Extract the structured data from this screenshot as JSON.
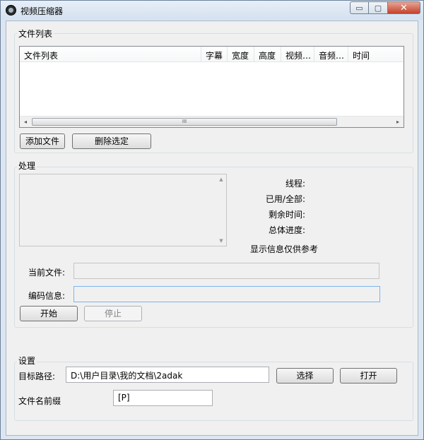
{
  "window": {
    "title": "视频压缩器",
    "min_glyph": "▭",
    "max_glyph": "▢",
    "close_glyph": "✕"
  },
  "file_list": {
    "group_label": "文件列表",
    "columns": [
      "文件列表",
      "字幕",
      "宽度",
      "高度",
      "视频…",
      "音频…",
      "时间"
    ],
    "scroll_left": "◂",
    "scroll_right": "▸",
    "thumb_grip": "III",
    "add_button": "添加文件",
    "delete_button": "删除选定"
  },
  "processing": {
    "group_label": "处理",
    "scroll_up": "▲",
    "scroll_down": "▼",
    "threads_label": "线程:",
    "used_total_label": "已用/全部:",
    "remaining_label": "剩余时间:",
    "overall_label": "总体进度:",
    "info_note": "显示信息仅供参考",
    "current_file_label": "当前文件:",
    "current_file_value": "",
    "encode_info_label": "编码信息:",
    "encode_info_value": "",
    "start_button": "开始",
    "stop_button": "停止"
  },
  "settings": {
    "group_label": "设置",
    "target_path_label": "目标路径:",
    "target_path_value": "D:\\用户目录\\我的文档\\2adak",
    "browse_button": "选择",
    "open_button": "打开",
    "prefix_label": "文件名前缀",
    "prefix_value": "[P]"
  }
}
